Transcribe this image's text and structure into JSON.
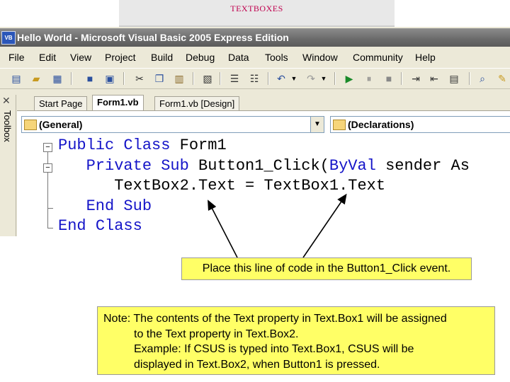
{
  "slide": {
    "title": "TEXTBOXES"
  },
  "window": {
    "app_icon": "VB",
    "title": "Hello World - Microsoft Visual Basic 2005 Express Edition"
  },
  "menu": [
    "File",
    "Edit",
    "View",
    "Project",
    "Build",
    "Debug",
    "Data",
    "Tools",
    "Window",
    "Community",
    "Help"
  ],
  "toolbox": {
    "close_glyph": "✕",
    "label": "Toolbox"
  },
  "tabs": [
    "Start Page",
    "Form1.vb",
    "Form1.vb [Design]"
  ],
  "combos": {
    "left": {
      "value": "(General)"
    },
    "right": {
      "value": "(Declarations)"
    }
  },
  "code": {
    "line1": {
      "kw1": "Public",
      "kw2": "Class",
      "name": "Form1"
    },
    "line2": {
      "kw1": "Private",
      "kw2": "Sub",
      "name": "Button1_Click(",
      "kw3": "ByVal",
      "rest": "sender As"
    },
    "line3": {
      "text": "TextBox2.Text = TextBox1.Text"
    },
    "line4": {
      "kw1": "End",
      "kw2": "Sub"
    },
    "line5": {
      "kw1": "End",
      "kw2": "Class"
    }
  },
  "callout": {
    "text": "Place this line of code in the Button1_Click event."
  },
  "note": {
    "line1": "Note: The contents of the Text property in Text.Box1 will be assigned",
    "line2": "to the Text property in Text.Box2.",
    "line3": "Example:  If CSUS is typed into Text.Box1, CSUS will be",
    "line4": "displayed in Text.Box2, when Button1 is pressed."
  },
  "colors": {
    "keyword": "#1414c8",
    "callout_bg": "#ffff66",
    "slide_title": "#c0004e"
  }
}
